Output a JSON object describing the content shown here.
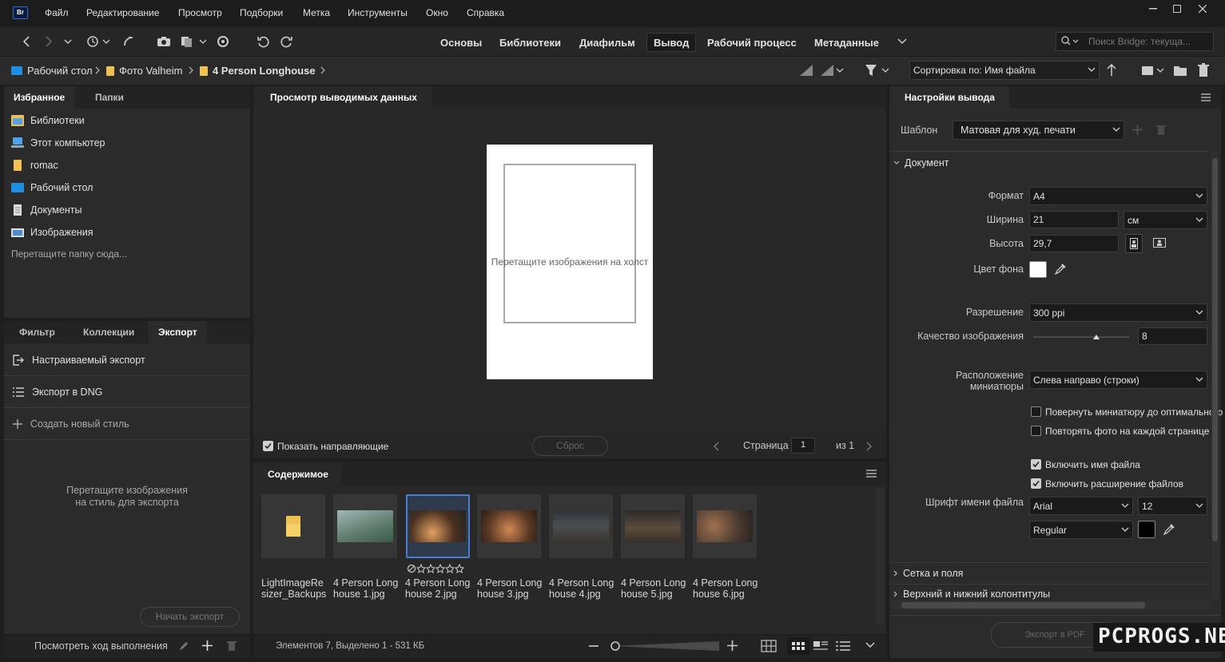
{
  "app": {
    "logo": "Br"
  },
  "menu": [
    "Файл",
    "Редактирование",
    "Просмотр",
    "Подборки",
    "Метка",
    "Инструменты",
    "Окно",
    "Справка"
  ],
  "workspaces": {
    "tabs": [
      "Основы",
      "Библиотеки",
      "Диафильм",
      "Вывод",
      "Рабочий процесс",
      "Метаданные"
    ],
    "active": "Вывод"
  },
  "search": {
    "placeholder": "Поиск Bridge: текуща..."
  },
  "breadcrumb": [
    "Рабочий стол",
    "Фото Valheim",
    "4 Person Longhouse"
  ],
  "sort": {
    "label": "Сортировка по: Имя файла"
  },
  "left_tabs_top": [
    "Избранное",
    "Папки"
  ],
  "favorites": [
    {
      "label": "Библиотеки",
      "icon": "libraries-icon"
    },
    {
      "label": "Этот компьютер",
      "icon": "computer-icon"
    },
    {
      "label": "romac",
      "icon": "folder-icon"
    },
    {
      "label": "Рабочий стол",
      "icon": "desktop-icon"
    },
    {
      "label": "Документы",
      "icon": "documents-icon"
    },
    {
      "label": "Изображения",
      "icon": "pictures-icon"
    }
  ],
  "favorites_hint": "Перетащите папку сюда...",
  "left_tabs_bottom": [
    "Фильтр",
    "Коллекции",
    "Экспорт"
  ],
  "export": {
    "items": [
      "Настраиваемый экспорт",
      "Экспорт в DNG"
    ],
    "new_style": "Создать новый стиль",
    "drop_hint_1": "Перетащите изображения",
    "drop_hint_2": "на стиль для экспорта",
    "start": "Начать экспорт",
    "progress": "Посмотреть ход выполнения"
  },
  "preview": {
    "tab": "Просмотр выводимых данных",
    "canvas_hint": "Перетащите изображения на холст",
    "show_guides": "Показать направляющие",
    "reset": "Сброс",
    "page_label": "Страница",
    "page": "1",
    "of": "из 1"
  },
  "content": {
    "tab": "Содержимое",
    "items": [
      {
        "caption": "LightImageResizer_Backups",
        "type": "folder"
      },
      {
        "caption": "4 Person Longhouse 1.jpg",
        "type": "image",
        "color": "#6f8a8c"
      },
      {
        "caption": "4 Person Longhouse 2.jpg",
        "type": "image",
        "color": "#5a4030",
        "selected": true
      },
      {
        "caption": "4 Person Longhouse 3.jpg",
        "type": "image",
        "color": "#6a4a32"
      },
      {
        "caption": "4 Person Longhouse 4.jpg",
        "type": "image",
        "color": "#3d4245"
      },
      {
        "caption": "4 Person Longhouse 5.jpg",
        "type": "image",
        "color": "#4a4038"
      },
      {
        "caption": "4 Person Longhouse 6.jpg",
        "type": "image",
        "color": "#5a4a3c"
      }
    ],
    "status": "Элементов 7, Выделено 1 - 531 КБ",
    "rating_stars": 0
  },
  "output": {
    "tab": "Настройки вывода",
    "template_label": "Шаблон",
    "template": "Матовая для худ. печати",
    "document_section": "Документ",
    "format_label": "Формат",
    "format": "A4",
    "width_label": "Ширина",
    "width": "21",
    "unit": "см",
    "height_label": "Высота",
    "height": "29,7",
    "bg_label": "Цвет фона",
    "bg_color": "#ffffff",
    "resolution_label": "Разрешение",
    "resolution": "300 ppi",
    "quality_label": "Качество изображения",
    "quality": "8",
    "quality_max": 12,
    "layout_label_1": "Расположение",
    "layout_label_2": "миниатюры",
    "layout": "Слева направо (строки)",
    "rotate": "Повернуть миниатюру до оптимального",
    "repeat": "Повторять фото на каждой странице",
    "include_name": "Включить имя файла",
    "include_ext": "Включить расширение файлов",
    "font_label": "Шрифт имени файла",
    "font": "Arial",
    "font_size": "12",
    "font_style": "Regular",
    "font_color": "#000000",
    "grid_section": "Сетка и поля",
    "header_section": "Верхний и нижний колонтитулы",
    "export_pdf": "Экспорт в PDF"
  },
  "watermark": "PCPROGS.NET"
}
